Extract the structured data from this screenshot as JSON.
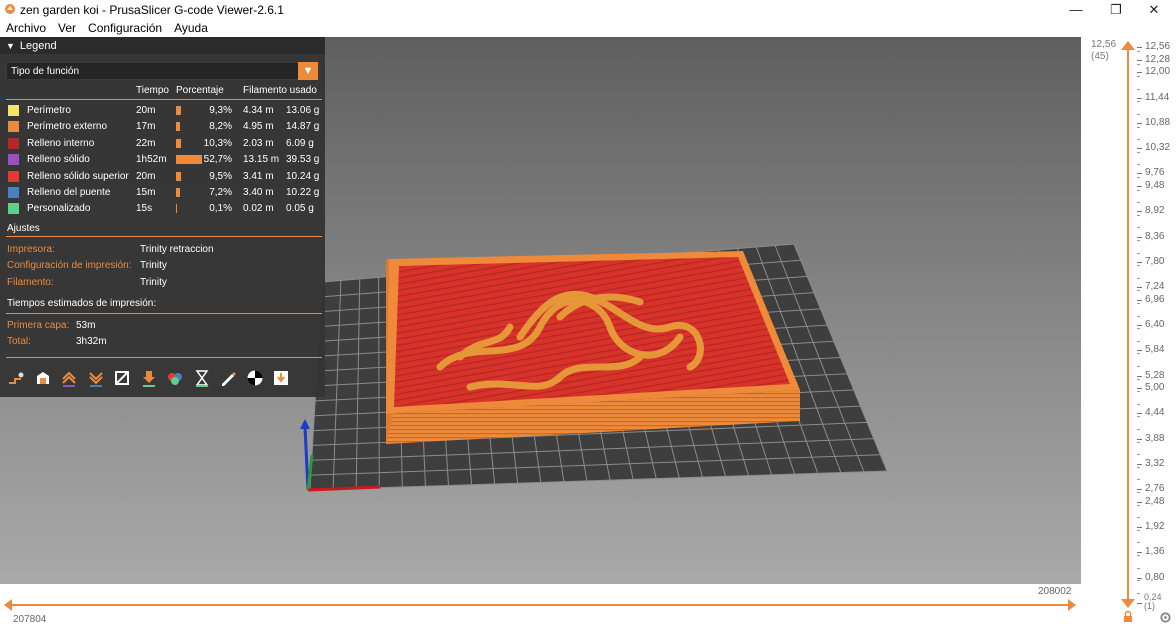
{
  "window": {
    "title": "zen garden koi - PrusaSlicer G-code Viewer-2.6.1",
    "minimize_glyph": "—",
    "maximize_glyph": "❐",
    "close_glyph": "✕"
  },
  "menu": {
    "items": [
      "Archivo",
      "Ver",
      "Configuración",
      "Ayuda"
    ]
  },
  "legend": {
    "title": "Legend",
    "view_type": "Tipo de función",
    "columns": {
      "time": "Tiempo",
      "percent": "Porcentaje",
      "filament": "Filamento usado"
    },
    "features": [
      {
        "name": "Perímetro",
        "color": "#f5e36a",
        "time": "20m",
        "percent_value": 9.3,
        "percent": "9,3%",
        "length": "4.34 m",
        "weight": "13.06 g"
      },
      {
        "name": "Perímetro externo",
        "color": "#ee8a3a",
        "time": "17m",
        "percent_value": 8.2,
        "percent": "8,2%",
        "length": "4.95 m",
        "weight": "14.87 g"
      },
      {
        "name": "Relleno interno",
        "color": "#b02a2a",
        "time": "22m",
        "percent_value": 10.3,
        "percent": "10,3%",
        "length": "2.03 m",
        "weight": "6.09 g"
      },
      {
        "name": "Relleno sólido",
        "color": "#9a4fc4",
        "time": "1h52m",
        "percent_value": 52.7,
        "percent": "52,7%",
        "length": "13.15 m",
        "weight": "39.53 g"
      },
      {
        "name": "Relleno sólido superior",
        "color": "#e8382f",
        "time": "20m",
        "percent_value": 9.5,
        "percent": "9,5%",
        "length": "3.41 m",
        "weight": "10.24 g"
      },
      {
        "name": "Relleno del puente",
        "color": "#4a7fc0",
        "time": "15m",
        "percent_value": 7.2,
        "percent": "7,2%",
        "length": "3.40 m",
        "weight": "10.22 g"
      },
      {
        "name": "Personalizado",
        "color": "#5fcf8a",
        "time": "15s",
        "percent_value": 0.1,
        "percent": "0,1%",
        "length": "0.02 m",
        "weight": "0.05 g"
      }
    ],
    "settings_title": "Ajustes",
    "settings": [
      {
        "key": "Impresora:",
        "value": "Trinity retraccion"
      },
      {
        "key": "Configuración de impresión:",
        "value": "Trinity"
      },
      {
        "key": "Filamento:",
        "value": "Trinity"
      }
    ],
    "times_title": "Tiempos estimados de impresión:",
    "times": [
      {
        "key": "Primera capa:",
        "value": "53m"
      },
      {
        "key": "Total:",
        "value": "3h32m"
      }
    ]
  },
  "hslider": {
    "min_label": "207804",
    "max_label": "208002"
  },
  "vslider": {
    "top_value": "12,56",
    "top_index": "(45)",
    "bottom_value": "0,24",
    "bottom_index": "(1)",
    "ticks": [
      "12,56",
      "12,28",
      "12,00",
      "11,44",
      "10,88",
      "10,32",
      "9,76",
      "9,48",
      "8,92",
      "8,36",
      "7,80",
      "7,24",
      "6,96",
      "6,40",
      "5,84",
      "5,28",
      "5,00",
      "4,44",
      "3,88",
      "3,32",
      "2,76",
      "2,48",
      "1,92",
      "1,36",
      "0,80",
      "0,24"
    ]
  },
  "colors": {
    "accent": "#ee8a3a",
    "panel": "#343434",
    "bed_line": "#8a8a8a"
  }
}
